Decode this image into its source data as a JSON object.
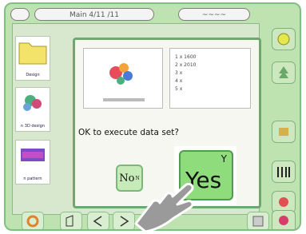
{
  "header": {
    "home_pill": "",
    "title_pill": "Main 4/11 /11",
    "right_pill_text": "~~~~",
    "right_pill_small": "~~~~"
  },
  "thumbnails": [
    {
      "label": "Design"
    },
    {
      "label": "n 3D design"
    },
    {
      "label": "n pattern"
    }
  ],
  "dialog": {
    "question": "OK to execute data set?",
    "no_label": "No",
    "no_sup": "N",
    "yes_label": "Yes",
    "yes_key": "Y",
    "info_lines": [
      "1 x 1600",
      "2 x 2010",
      "3 x",
      "4 x",
      "5 x"
    ]
  },
  "colors": {
    "screen_bg": "#bfe3b0",
    "dialog_border": "#6fa86f",
    "yes_bg": "#8fdc7d"
  }
}
